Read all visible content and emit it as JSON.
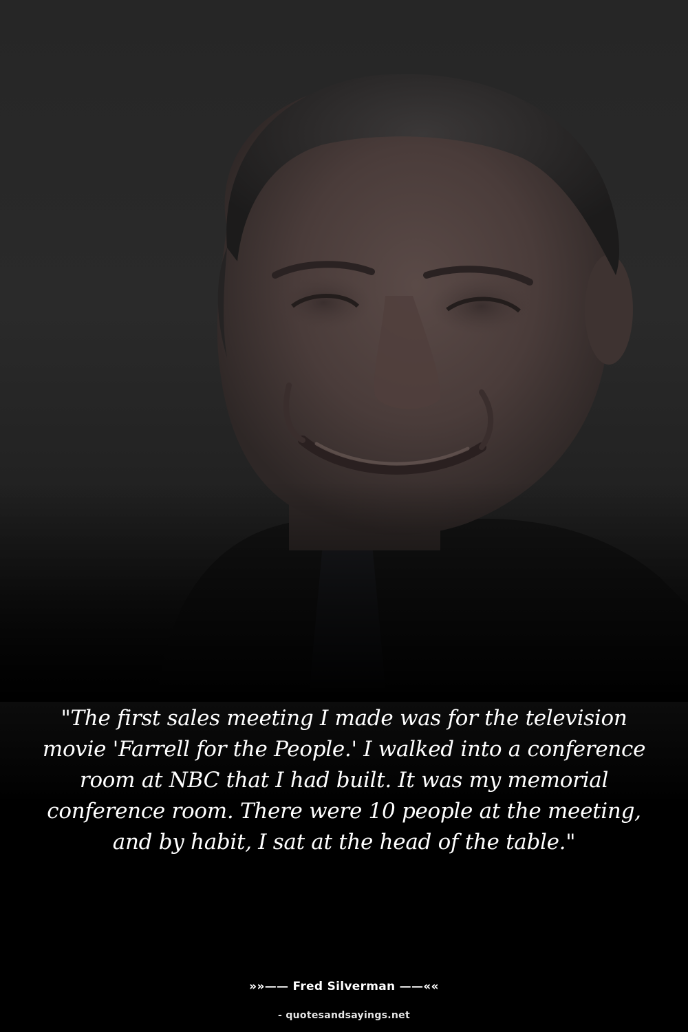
{
  "quote": {
    "text": "\"The first sales meeting I made was for the television movie 'Farrell for the People.' I walked into a conference room at NBC that I had built. It was my memorial conference room. There were 10 people at the meeting, and by habit, I sat at the head of the table.\""
  },
  "attribution": {
    "author": "»»—— Fred Silverman ——««",
    "source": "- quotesandsayings.net"
  },
  "colors": {
    "background": "#000000",
    "text": "#ffffff"
  }
}
